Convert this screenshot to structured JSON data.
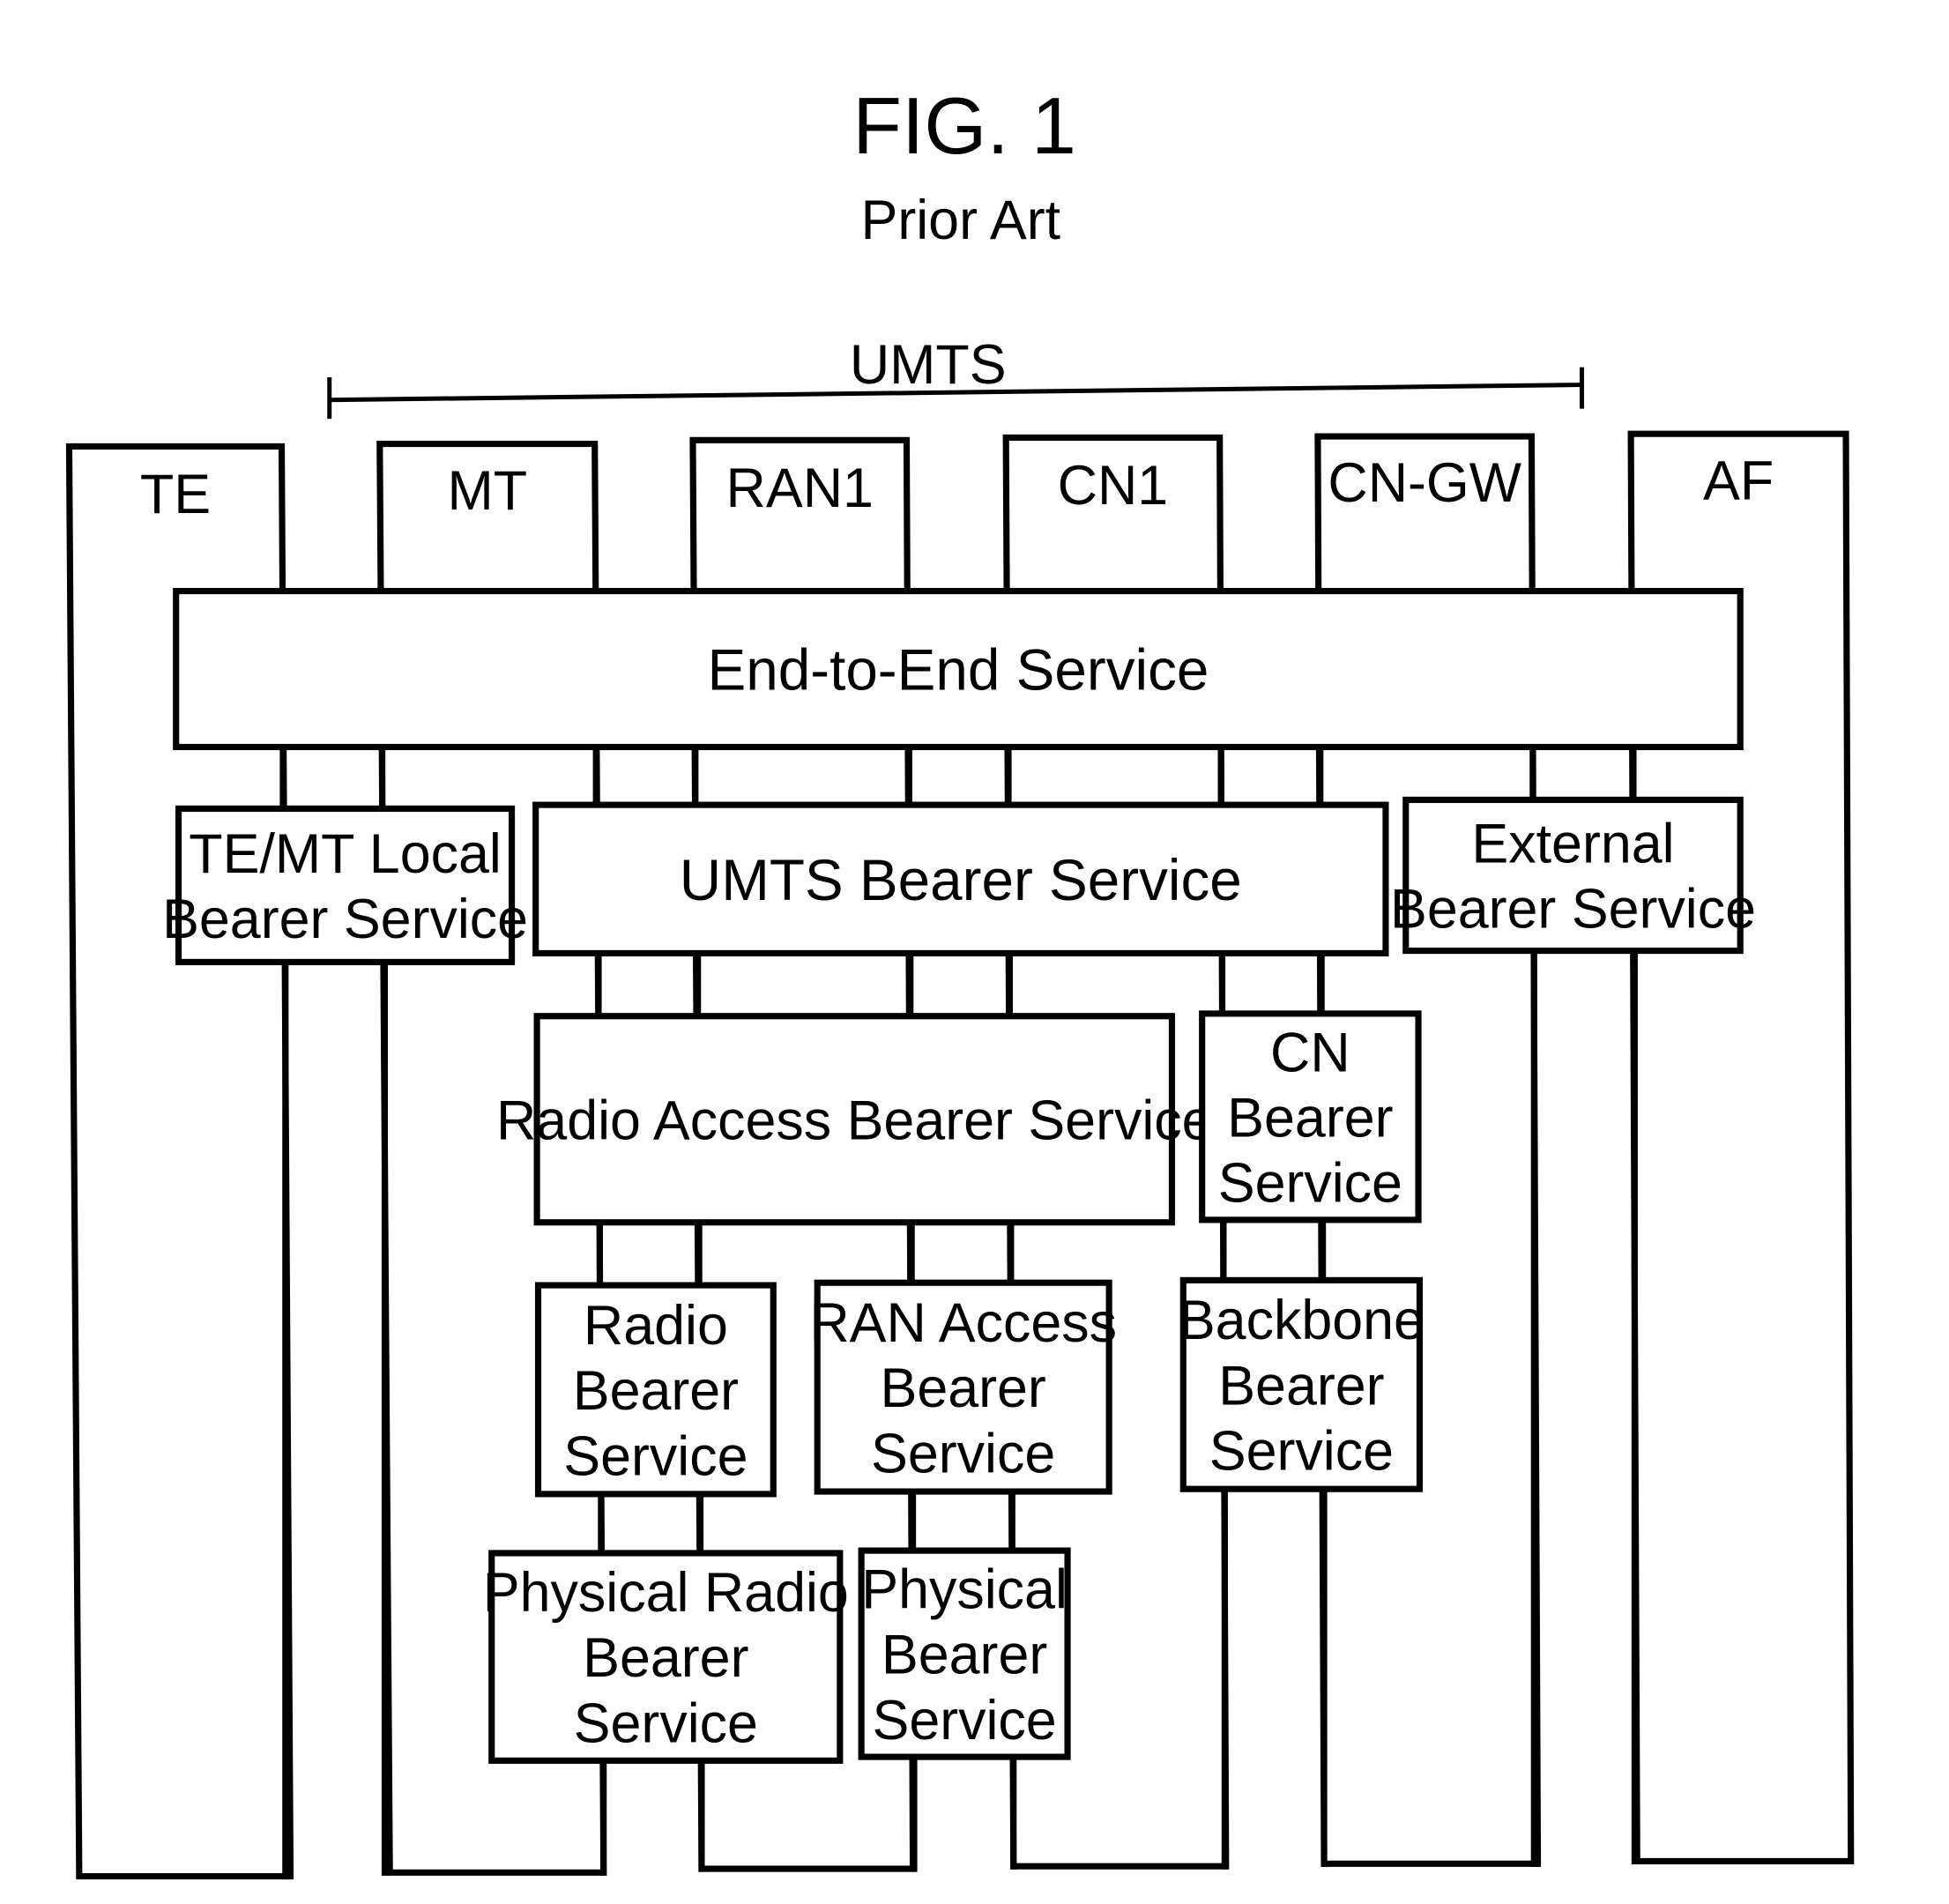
{
  "figure": {
    "title": "FIG. 1",
    "subtitle": "Prior Art"
  },
  "umts_span": {
    "label": "UMTS",
    "spans_from": "MT",
    "spans_to": "CN-GW"
  },
  "columns": [
    {
      "id": "te",
      "label": "TE"
    },
    {
      "id": "mt",
      "label": "MT"
    },
    {
      "id": "ran1",
      "label": "RAN1"
    },
    {
      "id": "cn1",
      "label": "CN1"
    },
    {
      "id": "cngw",
      "label": "CN-GW"
    },
    {
      "id": "af",
      "label": "AF"
    }
  ],
  "services": [
    {
      "id": "end-to-end",
      "lines": [
        "End-to-End Service"
      ]
    },
    {
      "id": "te-mt-local",
      "lines": [
        "TE/MT Local",
        "Bearer Service"
      ]
    },
    {
      "id": "umts-bearer",
      "lines": [
        "UMTS Bearer Service"
      ]
    },
    {
      "id": "external-bearer",
      "lines": [
        "External",
        "Bearer Service"
      ]
    },
    {
      "id": "radio-access-bearer",
      "lines": [
        "Radio Access Bearer Service"
      ]
    },
    {
      "id": "cn-bearer",
      "lines": [
        "CN",
        "Bearer",
        "Service"
      ]
    },
    {
      "id": "radio-bearer",
      "lines": [
        "Radio",
        "Bearer",
        "Service"
      ]
    },
    {
      "id": "ran-access-bearer",
      "lines": [
        "RAN Access",
        "Bearer",
        "Service"
      ]
    },
    {
      "id": "backbone-bearer",
      "lines": [
        "Backbone",
        "Bearer",
        "Service"
      ]
    },
    {
      "id": "physical-radio-bearer",
      "lines": [
        "Physical Radio",
        "Bearer",
        "Service"
      ]
    },
    {
      "id": "physical-bearer",
      "lines": [
        "Physical",
        "Bearer",
        "Service"
      ]
    }
  ],
  "colors": {
    "line": "#000000",
    "background": "#ffffff"
  }
}
